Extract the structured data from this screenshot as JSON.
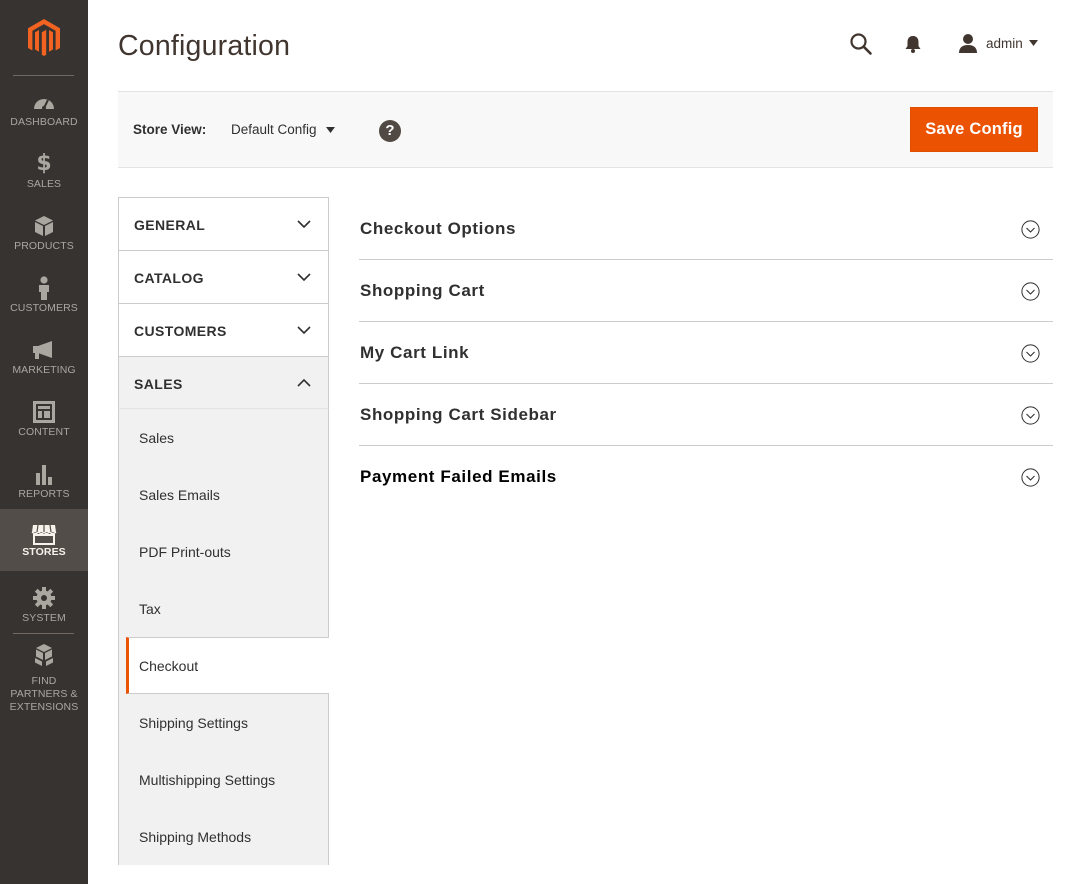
{
  "header": {
    "page_title": "Configuration",
    "user_name": "admin"
  },
  "admin_menu": {
    "items": [
      {
        "label": "DASHBOARD",
        "icon": "dashboard-icon"
      },
      {
        "label": "SALES",
        "icon": "dollar-icon"
      },
      {
        "label": "PRODUCTS",
        "icon": "box-icon"
      },
      {
        "label": "CUSTOMERS",
        "icon": "person-icon"
      },
      {
        "label": "MARKETING",
        "icon": "megaphone-icon"
      },
      {
        "label": "CONTENT",
        "icon": "layout-icon"
      },
      {
        "label": "REPORTS",
        "icon": "bar-chart-icon"
      },
      {
        "label": "STORES",
        "icon": "storefront-icon",
        "active": true
      },
      {
        "label": "SYSTEM",
        "icon": "gear-icon"
      },
      {
        "label": "FIND PARTNERS & EXTENSIONS",
        "icon": "cubes-icon"
      }
    ]
  },
  "scope": {
    "label": "Store View:",
    "value": "Default Config"
  },
  "actions": {
    "save_label": "Save Config"
  },
  "config_tabs": {
    "groups": [
      {
        "label": "GENERAL",
        "expanded": false
      },
      {
        "label": "CATALOG",
        "expanded": false
      },
      {
        "label": "CUSTOMERS",
        "expanded": false
      },
      {
        "label": "SALES",
        "expanded": true
      }
    ],
    "sales_items": [
      {
        "label": "Sales"
      },
      {
        "label": "Sales Emails"
      },
      {
        "label": "PDF Print-outs"
      },
      {
        "label": "Tax"
      },
      {
        "label": "Checkout",
        "active": true
      },
      {
        "label": "Shipping Settings"
      },
      {
        "label": "Multishipping Settings"
      },
      {
        "label": "Shipping Methods"
      }
    ]
  },
  "sections": [
    {
      "title": "Checkout Options"
    },
    {
      "title": "Shopping Cart"
    },
    {
      "title": "My Cart Link"
    },
    {
      "title": "Shopping Cart Sidebar"
    },
    {
      "title": "Payment Failed Emails"
    }
  ],
  "colors": {
    "menu_bg": "#373330",
    "menu_active_bg": "#524d49",
    "accent": "#eb5202",
    "logo": "#f26322"
  }
}
